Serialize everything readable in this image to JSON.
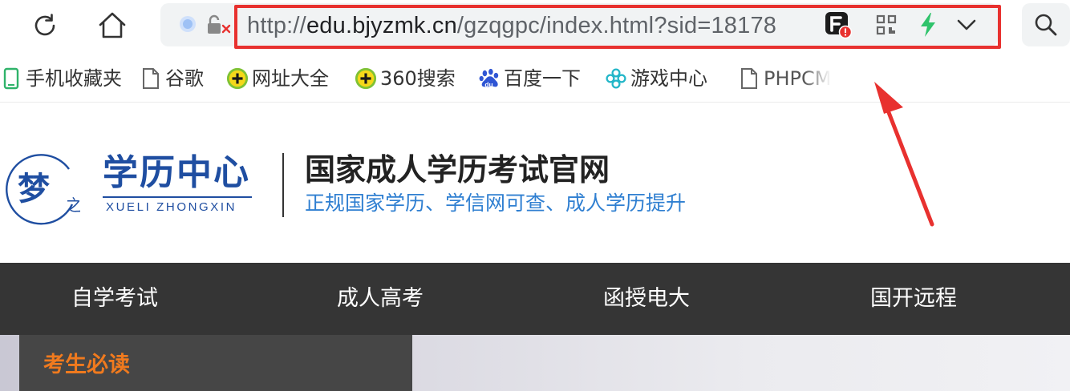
{
  "browser": {
    "url_scheme": "http://",
    "url_host": "edu.bjyzmk.cn",
    "url_path": "/gzqgpc/index.html?sid=18178"
  },
  "bookmarks": [
    {
      "label": "手机收藏夹",
      "icon": "phone-icon"
    },
    {
      "label": "谷歌",
      "icon": "page-icon"
    },
    {
      "label": "网址大全",
      "icon": "plus-circle-icon"
    },
    {
      "label": "360搜索",
      "icon": "plus-circle-icon"
    },
    {
      "label": "百度一下",
      "icon": "baidu-paw-icon"
    },
    {
      "label": "游戏中心",
      "icon": "game-clover-icon"
    },
    {
      "label": "PHPCM",
      "icon": "page-icon"
    }
  ],
  "site": {
    "logo_char": "梦",
    "logo_small": "之",
    "logo_title": "学历中心",
    "logo_pinyin": "XUELI ZHONGXIN",
    "title": "国家成人学历考试官网",
    "slogan": "正规国家学历、学信网可查、成人学历提升"
  },
  "nav": [
    {
      "label": "自学考试"
    },
    {
      "label": "成人高考"
    },
    {
      "label": "函授电大"
    },
    {
      "label": "国开远程"
    }
  ],
  "sidebar": {
    "title": "考生必读"
  },
  "colors": {
    "highlight_box": "#e8312f",
    "logo_blue": "#1f4ea1",
    "slogan_blue": "#2f7fd1",
    "nav_bg": "#353535",
    "side_title_orange": "#f07a1e"
  }
}
